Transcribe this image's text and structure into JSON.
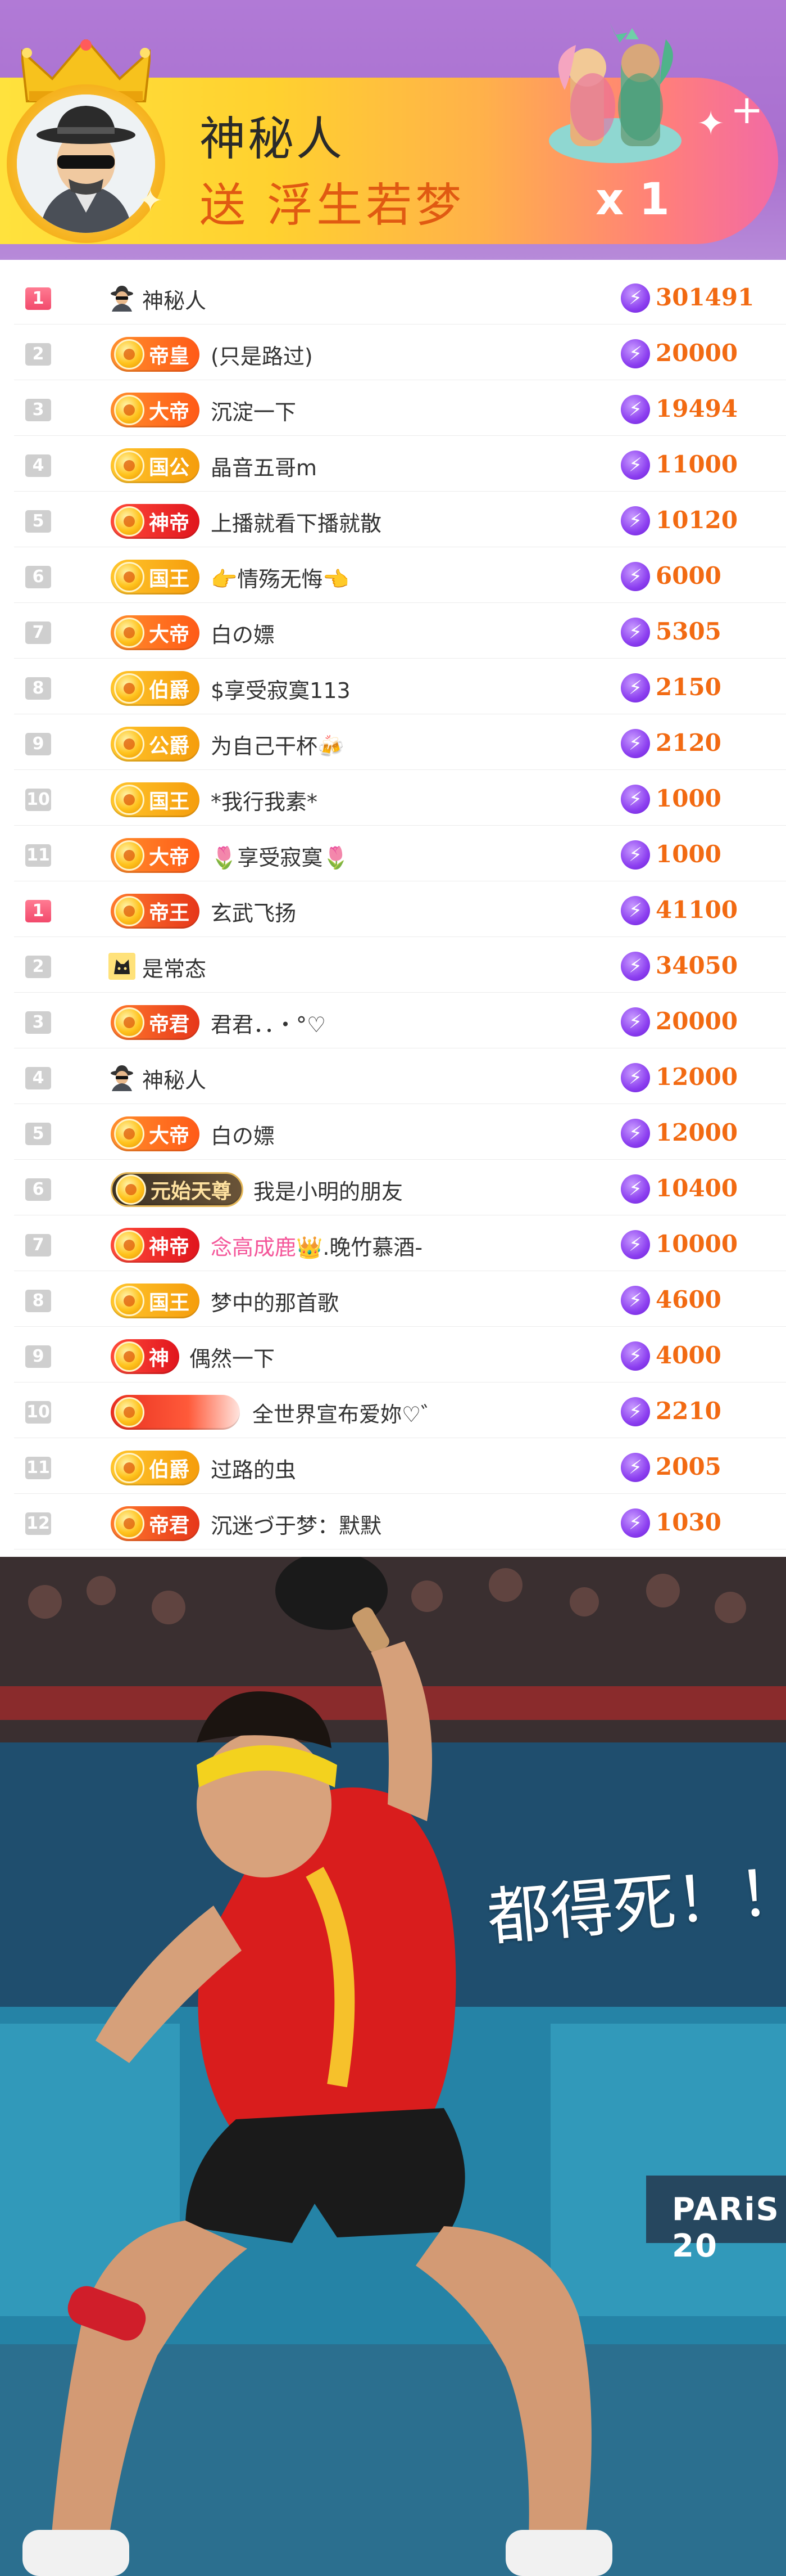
{
  "banner": {
    "sender": "神秘人",
    "gift_text": "送 浮生若梦",
    "count": "x 1"
  },
  "leaderboards": [
    {
      "rows": [
        {
          "rank": "1",
          "badge": "",
          "badge_style": "",
          "name": "神秘人",
          "score": "301491",
          "icon": "mystery"
        },
        {
          "rank": "2",
          "badge": "帝皇",
          "badge_style": "b-orange",
          "name": "(只是路过)",
          "score": "20000"
        },
        {
          "rank": "3",
          "badge": "大帝",
          "badge_style": "b-orange",
          "name": "沉淀一下",
          "score": "19494"
        },
        {
          "rank": "4",
          "badge": "国公",
          "badge_style": "b-gold",
          "name": "晶音五哥m",
          "score": "11000"
        },
        {
          "rank": "5",
          "badge": "神帝",
          "badge_style": "b-red",
          "name": "上播就看下播就散",
          "score": "10120"
        },
        {
          "rank": "6",
          "badge": "国王",
          "badge_style": "b-gold",
          "name": "👉情殇无悔👈",
          "score": "6000"
        },
        {
          "rank": "7",
          "badge": "大帝",
          "badge_style": "b-orange",
          "name": "白の嫖",
          "score": "5305"
        },
        {
          "rank": "8",
          "badge": "伯爵",
          "badge_style": "b-gold",
          "name": "$享受寂寞113",
          "score": "2150"
        },
        {
          "rank": "9",
          "badge": "公爵",
          "badge_style": "b-gold",
          "name": "为自己干杯🍻",
          "score": "2120"
        },
        {
          "rank": "10",
          "badge": "国王",
          "badge_style": "b-gold",
          "name": "*我行我素*",
          "score": "1000"
        },
        {
          "rank": "11",
          "badge": "大帝",
          "badge_style": "b-orange",
          "name": "🌷享受寂寞🌷",
          "score": "1000"
        }
      ]
    },
    {
      "rows": [
        {
          "rank": "1",
          "badge": "帝王",
          "badge_style": "b-emper",
          "name": "玄武飞扬",
          "score": "41100"
        },
        {
          "rank": "2",
          "badge": "",
          "badge_style": "",
          "name": "是常态",
          "score": "34050",
          "icon": "cat"
        },
        {
          "rank": "3",
          "badge": "帝君",
          "badge_style": "b-emper",
          "name": "君君．．・°♡",
          "score": "20000"
        },
        {
          "rank": "4",
          "badge": "",
          "badge_style": "",
          "name": "神秘人",
          "score": "12000",
          "icon": "mystery"
        },
        {
          "rank": "5",
          "badge": "大帝",
          "badge_style": "b-orange",
          "name": "白の嫖",
          "score": "12000"
        },
        {
          "rank": "6",
          "badge": "元始天尊",
          "badge_style": "b-dark",
          "name": "我是小明的朋友",
          "score": "10400"
        },
        {
          "rank": "7",
          "badge": "神帝",
          "badge_style": "b-red",
          "name_pink": "念高成鹿👑",
          "name": ".晚竹慕酒-",
          "score": "10000"
        },
        {
          "rank": "8",
          "badge": "国王",
          "badge_style": "b-gold",
          "name": "梦中的那首歌",
          "score": "4600"
        },
        {
          "rank": "9",
          "badge": "神",
          "badge_style": "b-red",
          "name": "偶然一下",
          "score": "4000"
        },
        {
          "rank": "10",
          "badge": "",
          "badge_style": "b-fade",
          "name": "全世界宣布爱妳♡゛",
          "score": "2210"
        },
        {
          "rank": "11",
          "badge": "伯爵",
          "badge_style": "b-gold",
          "name": "过路的虫",
          "score": "2005"
        },
        {
          "rank": "12",
          "badge": "帝君",
          "badge_style": "b-emper",
          "name": "沉迷づ于梦：默默",
          "score": "1030"
        }
      ]
    }
  ],
  "meme": {
    "caption": "都得死！！",
    "sign": "PARiS 20"
  },
  "colors": {
    "score": "#f26a12",
    "top_rank": "#f24a6c",
    "banner_bg": "#a86fcf"
  }
}
